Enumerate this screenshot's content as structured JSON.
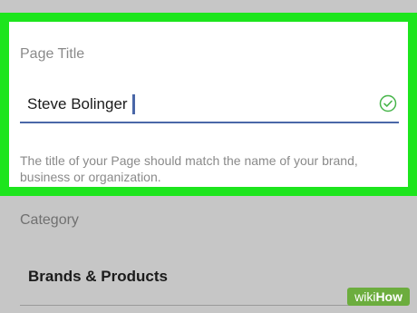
{
  "page_title_field": {
    "label": "Page Title",
    "value": "Steve Bolinger",
    "help_text": "The title of your Page should match the name of your brand, business or organization."
  },
  "category_field": {
    "label": "Category",
    "value": "Brands & Products"
  },
  "watermark": {
    "brand_part1": "wiki",
    "brand_part2": "How"
  },
  "colors": {
    "highlight_border": "#1de51d",
    "input_underline": "#4a67a8",
    "valid_check": "#47b54a",
    "watermark_bg": "#6cad3e"
  },
  "icons": {
    "valid": "check-circle-icon"
  }
}
